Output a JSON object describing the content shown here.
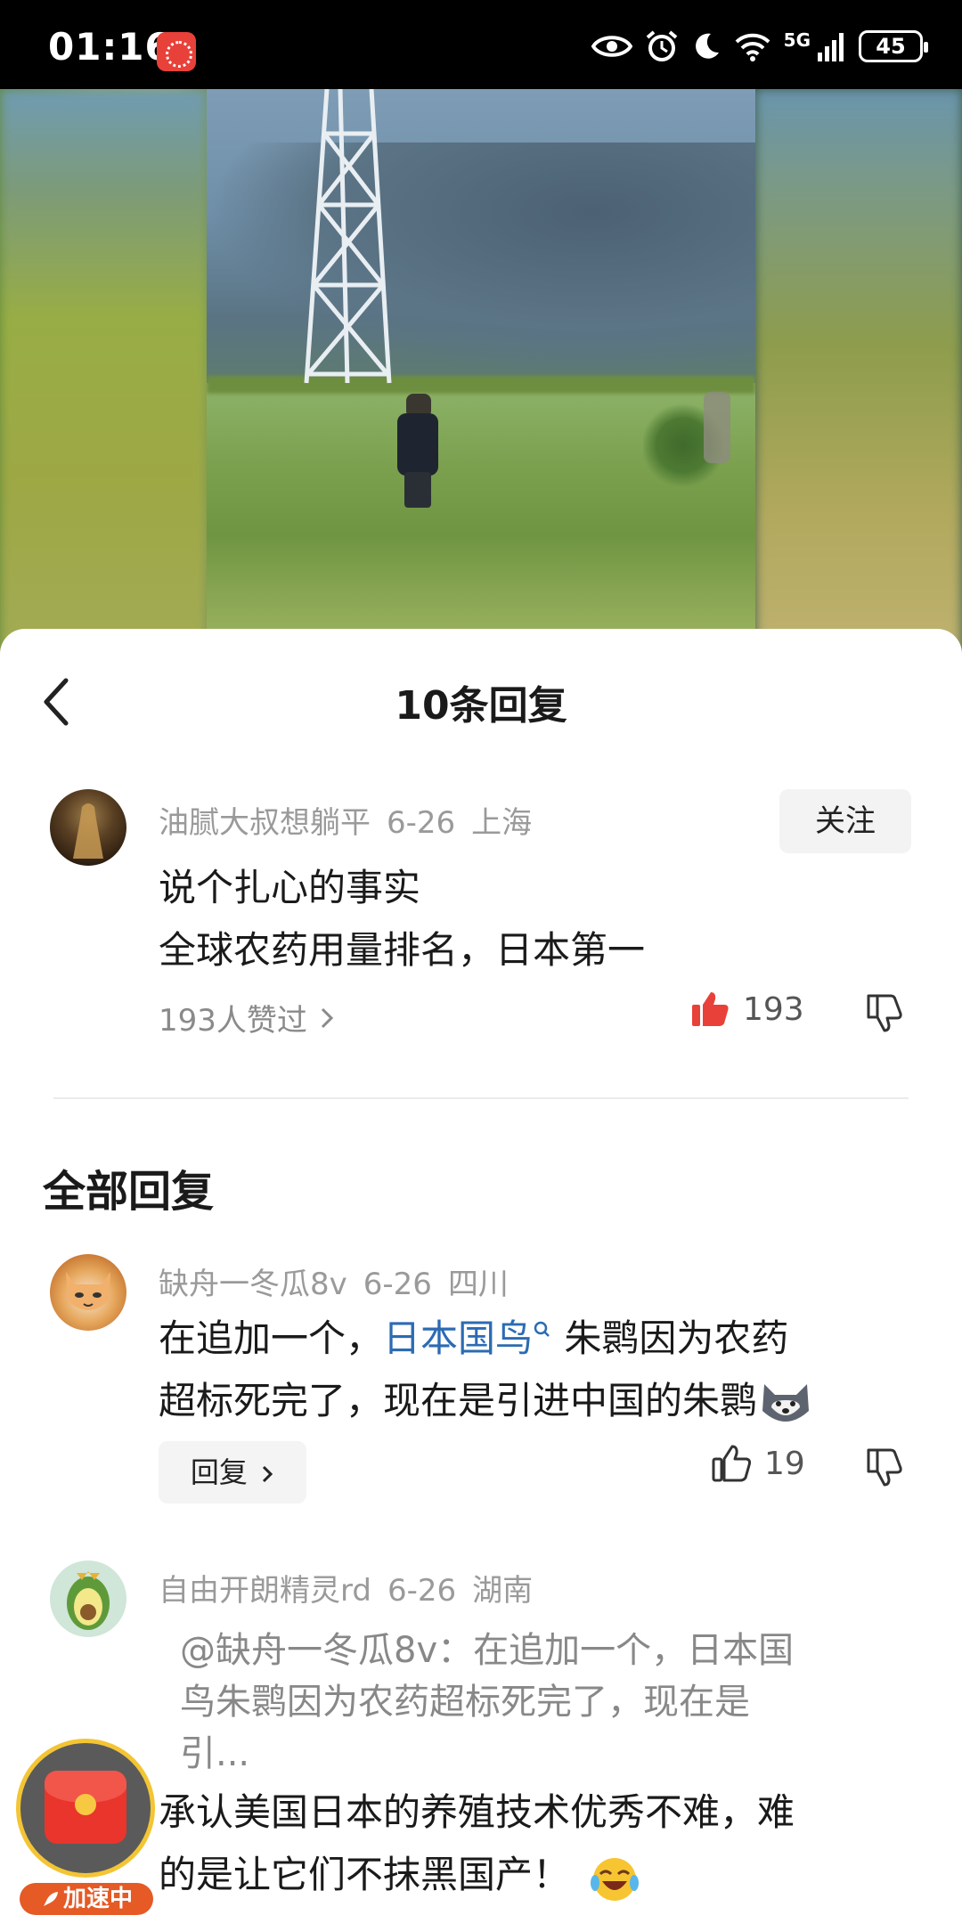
{
  "status_bar": {
    "time": "01:16",
    "network": "5G",
    "battery": "45"
  },
  "sheet": {
    "title": "10条回复"
  },
  "main_comment": {
    "user": "油腻大叔想躺平",
    "date": "6-26",
    "location": "上海",
    "follow_label": "关注",
    "lines": [
      "说个扎心的事实",
      "全球农药用量排名，日本第一"
    ],
    "likers_summary": "193人赞过",
    "like_count": "193"
  },
  "section_title": "全部回复",
  "replies": [
    {
      "user": "缺舟一冬瓜8v",
      "date": "6-26",
      "location": "四川",
      "line1_pre": "在追加一个，",
      "line1_link": "日本国鸟",
      "line1_post": " 朱鹮因为农药",
      "line2": "超标死完了，现在是引进中国的朱鹮",
      "reply_label": "回复",
      "like_count": "19"
    },
    {
      "user": "自由开朗精灵rd",
      "date": "6-26",
      "location": "湖南",
      "quote_lines": [
        "@缺舟一冬瓜8v：在追加一个，日本国",
        "鸟朱鹮因为农药超标死完了，现在是",
        "引..."
      ],
      "lines": [
        "承认美国日本的养殖技术优秀不难，难",
        "的是让它们不抹黑国产！"
      ]
    }
  ],
  "float_badge": {
    "label": "加速中"
  },
  "colors": {
    "link": "#2c6bb2",
    "like_active": "#e8413a",
    "meta": "#9a9a9a"
  }
}
